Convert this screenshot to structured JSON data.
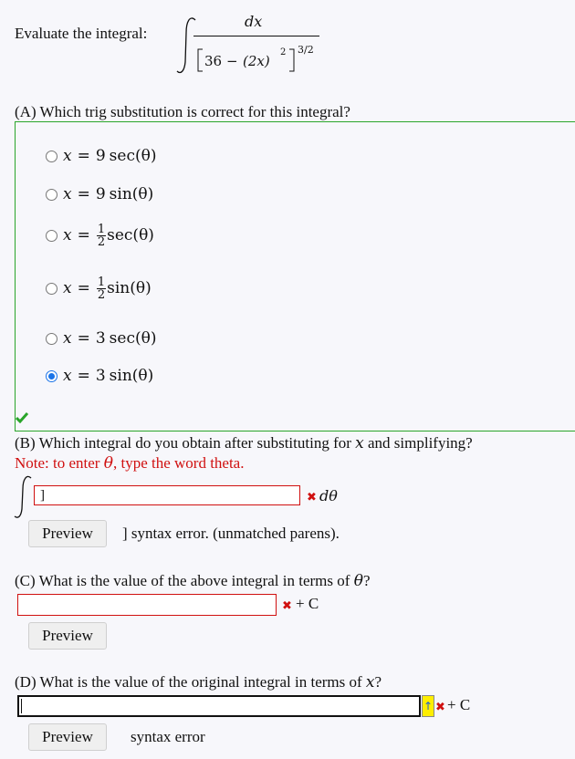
{
  "problem": {
    "prompt": "Evaluate the integral:",
    "integrand_num": "dx",
    "integrand_den_const": "36",
    "integrand_den_minus": "−",
    "integrand_den_term": "(2x)",
    "integrand_den_sq": "2",
    "integrand_den_pow": "3/2"
  },
  "part_a": {
    "question": "(A) Which trig substitution is correct for this integral?",
    "options": [
      {
        "lhs": "x",
        "coef": "9",
        "frac": null,
        "func": "sec(θ)",
        "selected": false
      },
      {
        "lhs": "x",
        "coef": "9",
        "frac": null,
        "func": "sin(θ)",
        "selected": false
      },
      {
        "lhs": "x",
        "coef": null,
        "frac": {
          "num": "1",
          "den": "2"
        },
        "func": "sec(θ)",
        "selected": false
      },
      {
        "lhs": "x",
        "coef": null,
        "frac": {
          "num": "1",
          "den": "2"
        },
        "func": "sin(θ)",
        "selected": false
      },
      {
        "lhs": "x",
        "coef": "3",
        "frac": null,
        "func": "sec(θ)",
        "selected": false
      },
      {
        "lhs": "x",
        "coef": "3",
        "frac": null,
        "func": "sin(θ)",
        "selected": true
      }
    ],
    "status": "correct",
    "status_color": "#2aa52a"
  },
  "part_b": {
    "question_pre": "(B) Which integral do you obtain after substituting for",
    "question_var": "x",
    "question_post": "and simplifying?",
    "note_pre": "Note: to enter",
    "note_var": "θ",
    "note_post": ", type the word theta.",
    "input_value": "]",
    "suffix": "dθ",
    "preview_label": "Preview",
    "preview_output": "] syntax error. (unmatched parens)."
  },
  "part_c": {
    "question_pre": "(C) What is the value of the above integral in terms of",
    "question_var": "θ",
    "question_post": "?",
    "input_value": "",
    "suffix": "+ C",
    "preview_label": "Preview"
  },
  "part_d": {
    "question_pre": "(D) What is the value of the original integral in terms of",
    "question_var": "x",
    "question_post": "?",
    "input_value": "",
    "suffix": "+ C",
    "preview_label": "Preview",
    "preview_output": "syntax error"
  },
  "colors": {
    "error_red": "#d01010",
    "correct_green": "#2aa52a",
    "radio_blue": "#1a73e8",
    "toggle_yellow": "#ffee00"
  }
}
